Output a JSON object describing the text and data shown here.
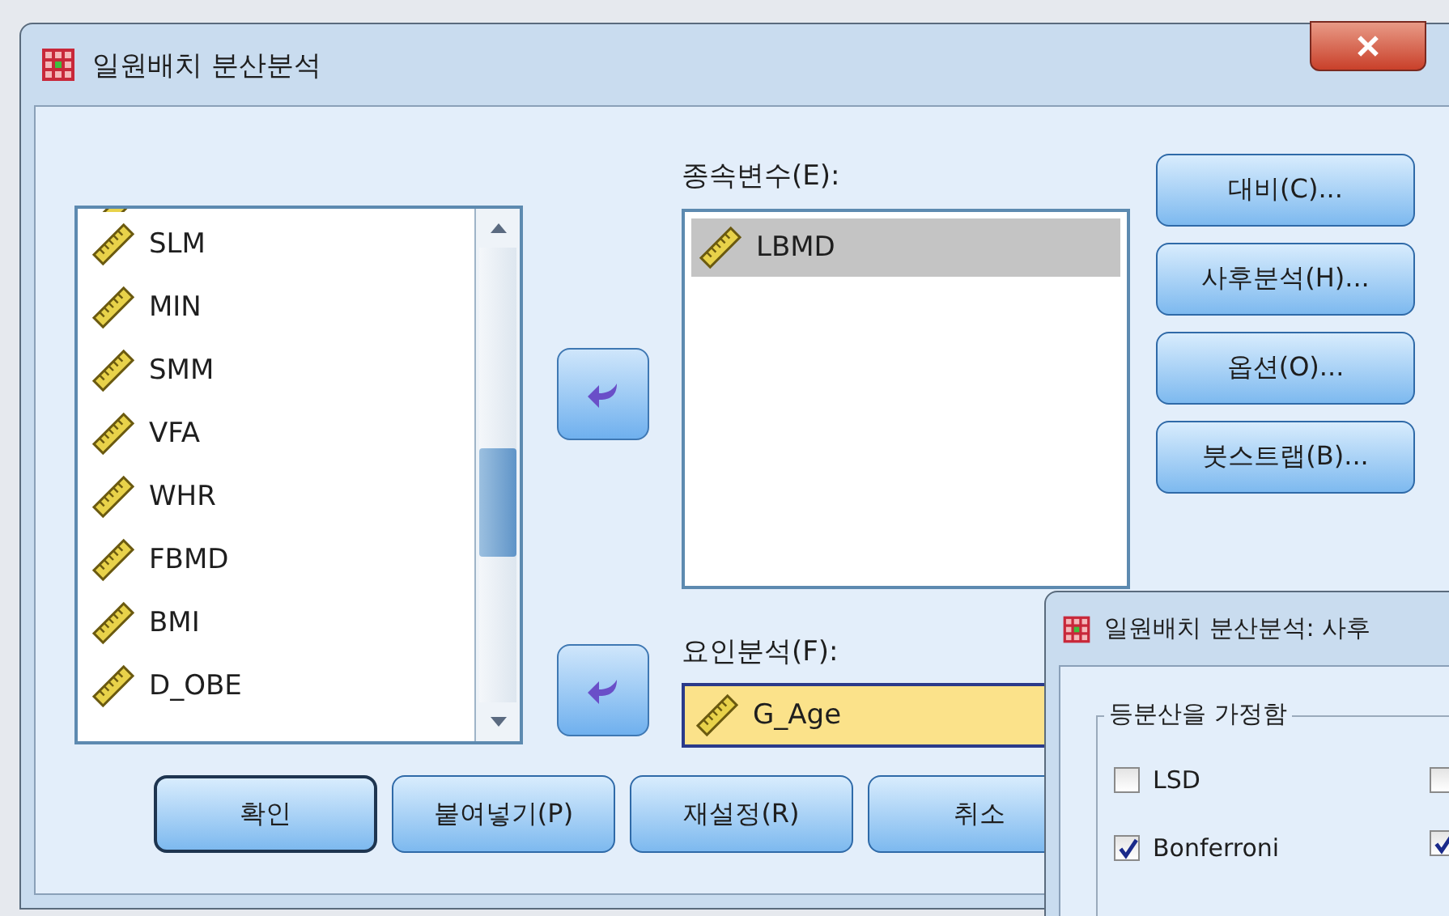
{
  "window": {
    "title": "일원배치 분산분석"
  },
  "variables": [
    {
      "name": "SLM"
    },
    {
      "name": "MIN"
    },
    {
      "name": "SMM"
    },
    {
      "name": "VFA"
    },
    {
      "name": "WHR"
    },
    {
      "name": "FBMD"
    },
    {
      "name": "BMI"
    },
    {
      "name": "D_OBE"
    }
  ],
  "dependent": {
    "label": "종속변수(E):",
    "items": [
      {
        "name": "LBMD",
        "selected": true
      }
    ]
  },
  "factor": {
    "label": "요인분석(F):",
    "value": "G_Age"
  },
  "side_buttons": [
    "대비(C)...",
    "사후분석(H)...",
    "옵션(O)...",
    "붓스트랩(B)..."
  ],
  "bottom_buttons": [
    {
      "label": "확인",
      "default": true
    },
    {
      "label": "붙여넣기(P)",
      "default": false
    },
    {
      "label": "재설정(R)",
      "default": false
    },
    {
      "label": "취소",
      "default": false
    }
  ],
  "post_hoc_window": {
    "title": "일원배치 분산분석: 사후",
    "group": "등분산을 가정함",
    "column_1": [
      {
        "label": "LSD",
        "checked": false
      },
      {
        "label": "Bonferroni",
        "checked": true
      }
    ],
    "column_2": [
      {
        "checked": false
      },
      {
        "checked": true
      }
    ]
  }
}
